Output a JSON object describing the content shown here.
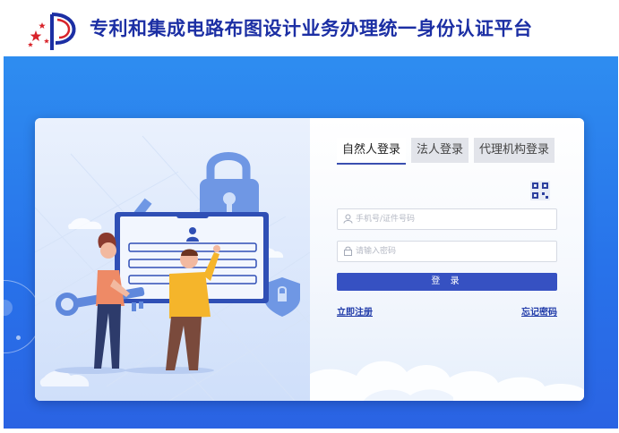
{
  "site": {
    "title": "专利和集成电路布图设计业务办理统一身份认证平台"
  },
  "login": {
    "tabs": [
      {
        "label": "自然人登录",
        "active": true
      },
      {
        "label": "法人登录",
        "active": false
      },
      {
        "label": "代理机构登录",
        "active": false
      }
    ],
    "phone_placeholder": "手机号/证件号码",
    "password_placeholder": "请输入密码",
    "login_button": "登 录",
    "register_link": "立即注册",
    "forgot_link": "忘记密码"
  },
  "icons": [
    "logo-icon",
    "qr-code-icon",
    "user-icon",
    "lock-icon"
  ],
  "colors": {
    "brand": "#1c2fa4",
    "banner": "#2a78ec",
    "button": "#3651c2",
    "link": "#1f3aa8"
  }
}
